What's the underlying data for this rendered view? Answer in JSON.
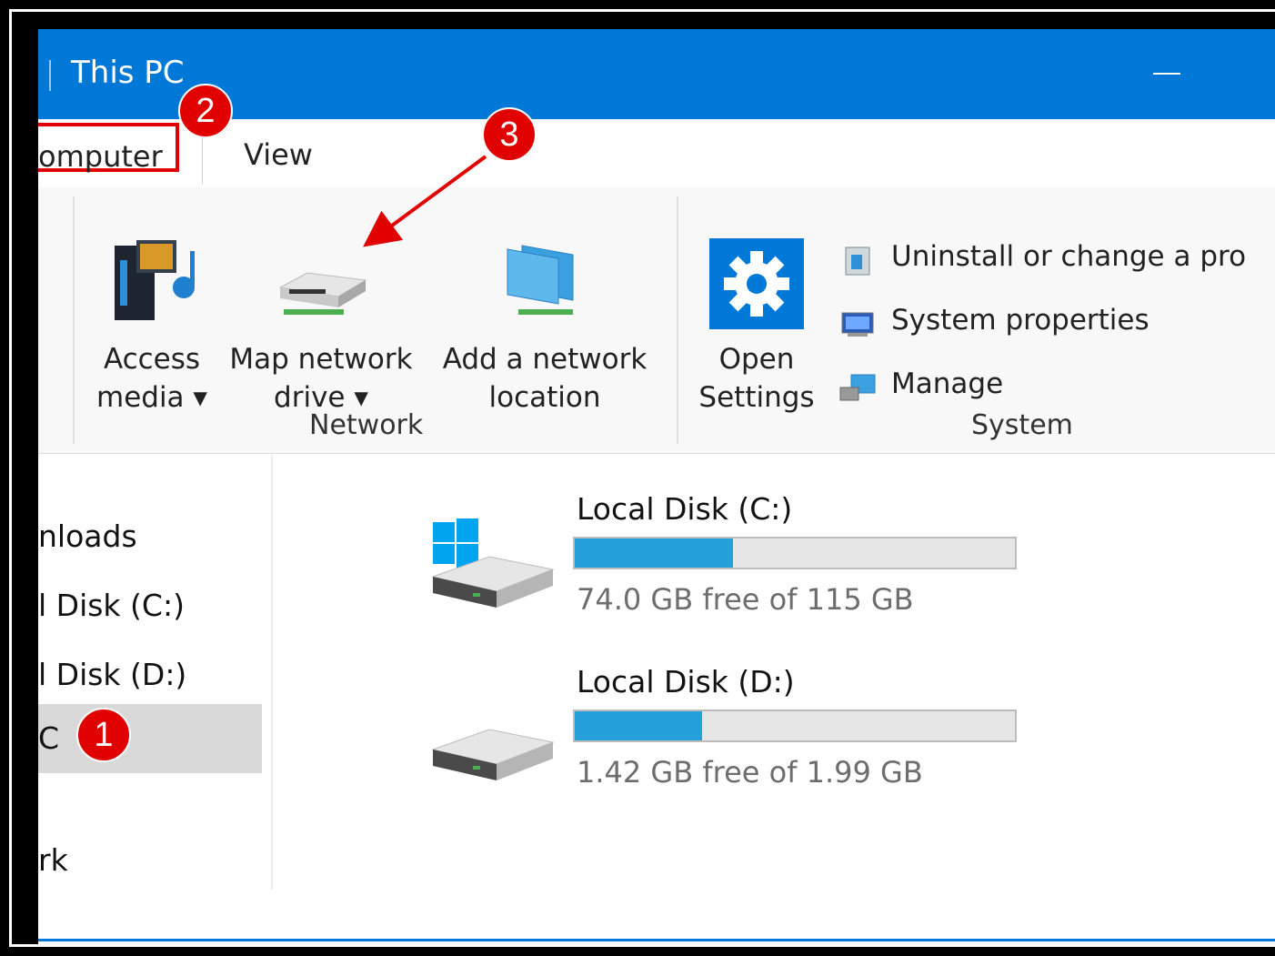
{
  "window": {
    "title": "This PC"
  },
  "tabs": {
    "computer": "omputer",
    "view": "View"
  },
  "ribbon": {
    "access_media": [
      "Access",
      "media"
    ],
    "map_network_drive": [
      "Map network",
      "drive"
    ],
    "add_network_location": [
      "Add a network",
      "location"
    ],
    "open_settings": [
      "Open",
      "Settings"
    ],
    "uninstall": "Uninstall or change a pro",
    "system_properties": "System properties",
    "manage": "Manage",
    "group_network": "Network",
    "group_system": "System"
  },
  "nav": {
    "items": [
      "nloads",
      "l Disk (C:)",
      "l Disk (D:)",
      "C",
      "rk"
    ]
  },
  "drives": [
    {
      "name": "Local Disk (C:)",
      "free_text": "74.0 GB free of 115 GB",
      "used_fraction": 0.36
    },
    {
      "name": "Local Disk (D:)",
      "free_text": "1.42 GB free of 1.99 GB",
      "used_fraction": 0.29
    }
  ],
  "annotations": {
    "one": "1",
    "two": "2",
    "three": "3"
  },
  "colors": {
    "accent": "#0078d7",
    "annotation": "#e00000",
    "bar_fill": "#26a0da"
  }
}
